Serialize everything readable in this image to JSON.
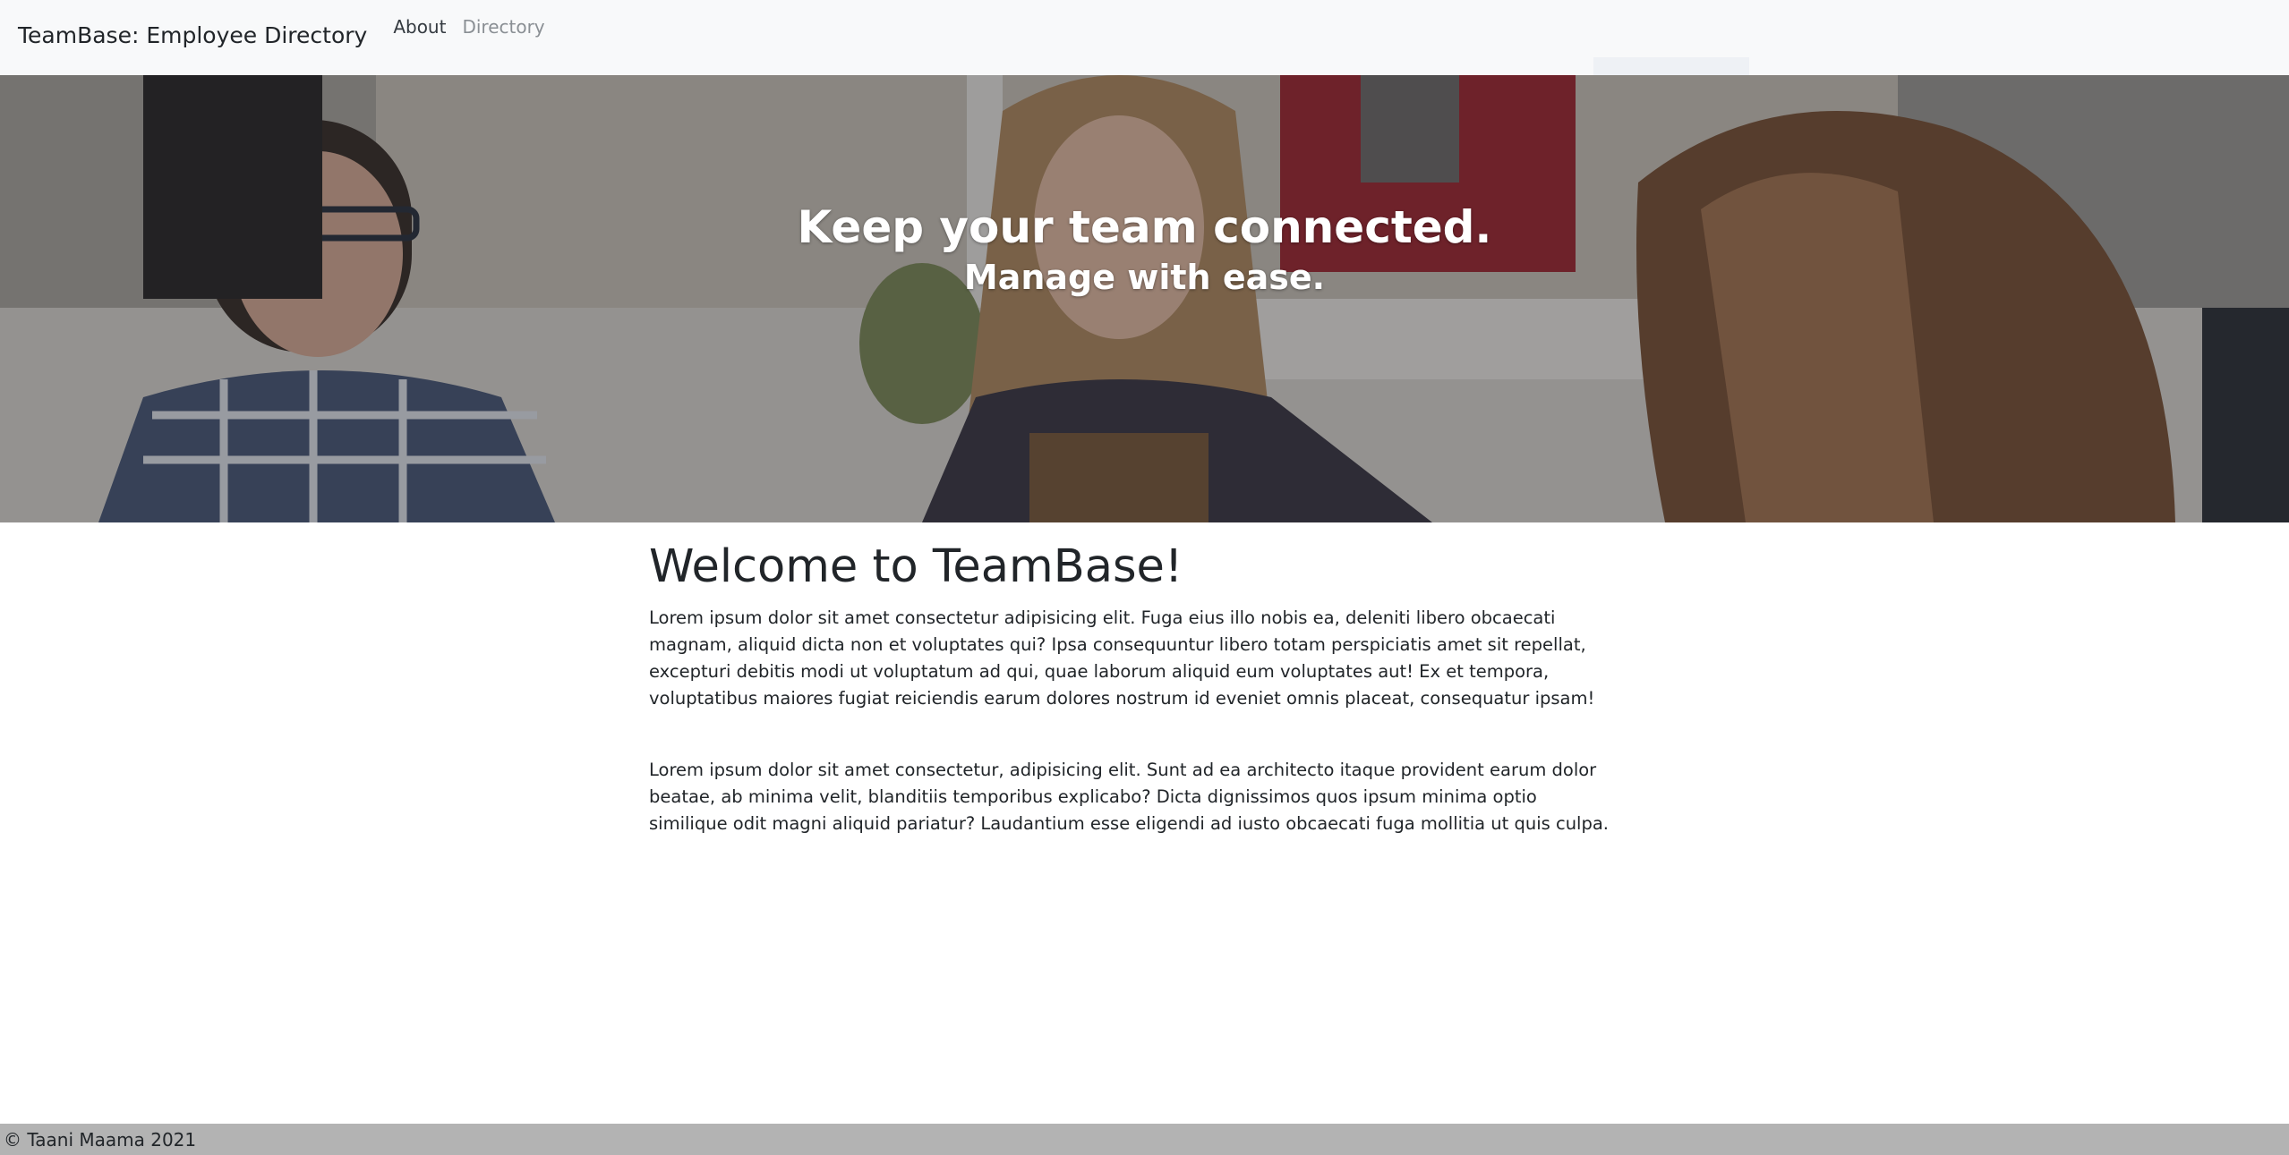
{
  "navbar": {
    "brand": "TeamBase: Employee Directory",
    "links": [
      {
        "label": "About",
        "active": true
      },
      {
        "label": "Directory",
        "active": false
      }
    ]
  },
  "hero": {
    "title": "Keep your team connected.",
    "subtitle": "Manage with ease."
  },
  "main": {
    "heading": "Welcome to TeamBase!",
    "paragraphs": [
      "Lorem ipsum dolor sit amet consectetur adipisicing elit. Fuga eius illo nobis ea, deleniti libero obcaecati magnam, aliquid dicta non et voluptates qui? Ipsa consequuntur libero totam perspiciatis amet sit repellat, excepturi debitis modi ut voluptatum ad qui, quae laborum aliquid eum voluptates aut! Ex et tempora, voluptatibus maiores fugiat reiciendis earum dolores nostrum id eveniet omnis placeat, consequatur ipsam!",
      "Lorem ipsum dolor sit amet consectetur, adipisicing elit. Sunt ad ea architecto itaque provident earum dolor beatae, ab minima velit, blanditiis temporibus explicabo? Dicta dignissimos quos ipsum minima optio similique odit magni aliquid pariatur? Laudantium esse eligendi ad iusto obcaecati fuga mollitia ut quis culpa."
    ]
  },
  "footer": {
    "text": "© Taani Maama 2021"
  },
  "colors": {
    "navbar_bg": "#f8f9fa",
    "footer_bg": "#b3b3b3",
    "text": "#212529",
    "muted_link": "#8a8f94"
  }
}
